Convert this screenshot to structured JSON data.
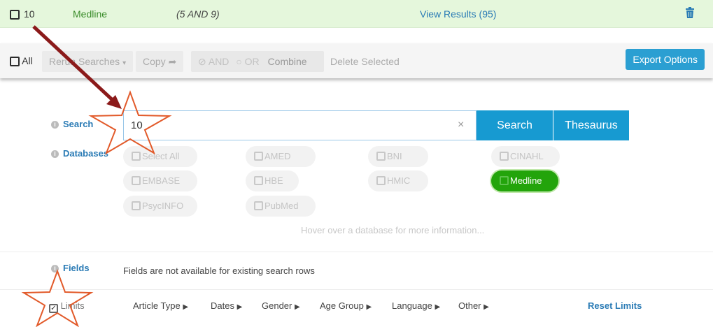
{
  "history_row": {
    "number": "10",
    "database": "Medline",
    "query": "(5 AND 9)",
    "view_results": "View Results (95)",
    "delete_icon": "trash-icon"
  },
  "toolbar": {
    "all_label": "All",
    "rerun_label": "Rerun Searches",
    "copy_label": "Copy",
    "and_label": "AND",
    "or_label": "OR",
    "combine_label": "Combine",
    "delete_selected_label": "Delete Selected",
    "export_label": "Export Options"
  },
  "search": {
    "label": "Search",
    "value": "10",
    "clear_glyph": "×",
    "search_button": "Search",
    "thesaurus_button": "Thesaurus"
  },
  "databases": {
    "label": "Databases",
    "items": [
      {
        "name": "Select All",
        "selected": false
      },
      {
        "name": "AMED",
        "selected": false
      },
      {
        "name": "BNI",
        "selected": false
      },
      {
        "name": "CINAHL",
        "selected": false
      },
      {
        "name": "EMBASE",
        "selected": false
      },
      {
        "name": "HBE",
        "selected": false
      },
      {
        "name": "HMIC",
        "selected": false
      },
      {
        "name": "Medline",
        "selected": true
      },
      {
        "name": "PsycINFO",
        "selected": false
      },
      {
        "name": "PubMed",
        "selected": false
      }
    ],
    "hint": "Hover over a database for more information..."
  },
  "fields": {
    "label": "Fields",
    "message": "Fields are not available for existing search rows"
  },
  "limits": {
    "label": "Limits",
    "checked": true,
    "menus": [
      "Article Type",
      "Dates",
      "Gender",
      "Age Group",
      "Language",
      "Other"
    ],
    "reset_label": "Reset Limits"
  },
  "colors": {
    "accent": "#179ad1",
    "selected_db": "#23a40b",
    "row_highlight": "#e5f7dc",
    "annotation_arrow": "#8b1a1a",
    "annotation_star": "#e25a2a"
  }
}
